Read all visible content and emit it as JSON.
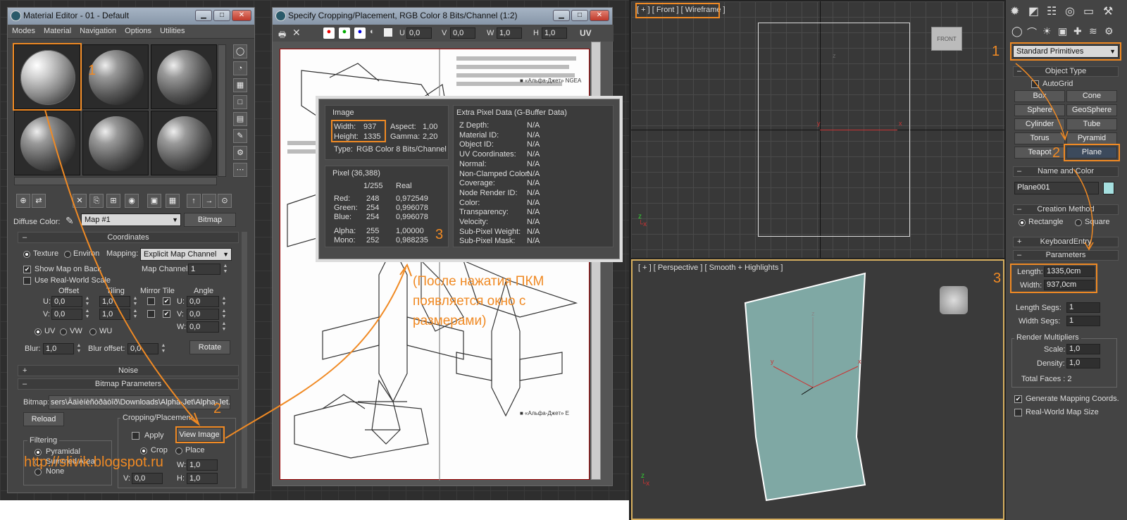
{
  "material_editor": {
    "title": "Material Editor - 01 - Default",
    "menus": [
      "Modes",
      "Material",
      "Navigation",
      "Options",
      "Utilities"
    ],
    "annotation_num": "1",
    "diffuse_label": "Diffuse Color:",
    "map_name": "Map #1",
    "map_type": "Bitmap",
    "coordinates": {
      "rollout": "Coordinates",
      "texture": "Texture",
      "environ": "Environ",
      "mapping_label": "Mapping:",
      "mapping_value": "Explicit Map Channel",
      "show_map": "Show Map on Back",
      "real_world": "Use Real-World Scale",
      "map_channel_label": "Map Channel:",
      "map_channel": "1",
      "offset": "Offset",
      "tiling": "Tiling",
      "mirror_tile": "Mirror Tile",
      "angle": "Angle",
      "u": "U:",
      "v": "V:",
      "w": "W:",
      "u_offset": "0,0",
      "v_offset": "0,0",
      "u_tiling": "1,0",
      "v_tiling": "1,0",
      "u_angle": "0,0",
      "v_angle": "0,0",
      "w_angle": "0,0",
      "uv": "UV",
      "vw": "VW",
      "wu": "WU",
      "blur_label": "Blur:",
      "blur": "1,0",
      "blur_offset_label": "Blur offset:",
      "blur_offset": "0,0",
      "rotate": "Rotate"
    },
    "noise_rollout": "Noise",
    "bitmap_rollout": "Bitmap Parameters",
    "bitmap_label": "Bitmap:",
    "bitmap_path": "sers\\Ääìèíèñòðàòîð\\Downloads\\Alpha-Jet\\Alpha-Jet.jpg",
    "reload": "Reload",
    "cropping_title": "Cropping/Placement",
    "apply": "Apply",
    "view_image": "View Image",
    "annotation_num2": "2",
    "crop": "Crop",
    "place": "Place",
    "filtering": "Filtering",
    "pyramidal": "Pyramidal",
    "summed_area": "Summed Area",
    "none": "None",
    "u_crop": "0,0",
    "w_crop": "1,0",
    "v_crop": "0,0",
    "h_crop": "1,0",
    "w_lbl": "W:",
    "h_lbl": "H:"
  },
  "crop_window": {
    "title": "Specify Cropping/Placement, RGB Color 8 Bits/Channel (1:2)",
    "u_label": "U",
    "u": "0,0",
    "v_label": "V",
    "v": "0,0",
    "w_label": "W",
    "w": "1,0",
    "h_label": "H",
    "h": "1,0",
    "uv": "UV",
    "doc_caption_1": "■ «Альфа-Джет» NGEA",
    "doc_caption_2": "■ «Альфа-Джет» E"
  },
  "info_popup": {
    "image_title": "Image",
    "width_label": "Width:",
    "width": "937",
    "height_label": "Height:",
    "height": "1335",
    "aspect_label": "Aspect:",
    "aspect": "1,00",
    "gamma_label": "Gamma:",
    "gamma": "2,20",
    "type_label": "Type:",
    "type": "RGB Color 8 Bits/Channel",
    "pixel_title": "Pixel (36,388)",
    "col_255": "1/255",
    "col_real": "Real",
    "rows": [
      {
        "label": "Red:",
        "v255": "248",
        "real": "0,972549"
      },
      {
        "label": "Green:",
        "v255": "254",
        "real": "0,996078"
      },
      {
        "label": "Blue:",
        "v255": "254",
        "real": "0,996078"
      }
    ],
    "alpha_label": "Alpha:",
    "alpha_255": "255",
    "alpha_real": "1,00000",
    "mono_label": "Mono:",
    "mono_255": "252",
    "mono_real": "0,988235",
    "annotation_num": "3",
    "extra_title": "Extra Pixel Data (G-Buffer Data)",
    "extra": [
      {
        "label": "Z Depth:",
        "value": "N/A"
      },
      {
        "label": "Material ID:",
        "value": "N/A"
      },
      {
        "label": "Object ID:",
        "value": "N/A"
      },
      {
        "label": "UV Coordinates:",
        "value": "N/A"
      },
      {
        "label": "Normal:",
        "value": "N/A"
      },
      {
        "label": "Non-Clamped Color:",
        "value": "N/A"
      },
      {
        "label": "Coverage:",
        "value": "N/A"
      },
      {
        "label": "Node Render ID:",
        "value": "N/A"
      },
      {
        "label": "Color:",
        "value": "N/A"
      },
      {
        "label": "Transparency:",
        "value": "N/A"
      },
      {
        "label": "Velocity:",
        "value": "N/A"
      },
      {
        "label": "Sub-Pixel Weight:",
        "value": "N/A"
      },
      {
        "label": "Sub-Pixel Mask:",
        "value": "N/A"
      }
    ]
  },
  "annotation_note": "(После нажатия ПКМ появляется окно с размерами)",
  "watermark": "http://slivik.blogspot.ru",
  "viewports": {
    "front_label": "[ + ] [ Front ] [ Wireframe ]",
    "persp_label": "[ + ] [ Perspective ] [ Smooth + Highlights ]",
    "front_cube": "FRONT"
  },
  "command_panel": {
    "category": "Standard Primitives",
    "annotation_1": "1",
    "annotation_2": "2",
    "annotation_3": "3",
    "object_type": "Object Type",
    "autogrid": "AutoGrid",
    "buttons": [
      "Box",
      "Cone",
      "Sphere",
      "GeoSphere",
      "Cylinder",
      "Tube",
      "Torus",
      "Pyramid",
      "Teapot",
      "Plane"
    ],
    "name_and_color": "Name and Color",
    "object_name": "Plane001",
    "color": "#a6e0e0",
    "creation_method": "Creation Method",
    "rectangle": "Rectangle",
    "square": "Square",
    "keyboard_entry": "KeyboardEntry",
    "parameters": "Parameters",
    "length_label": "Length:",
    "length": "1335,0cm",
    "width_label": "Width:",
    "width": "937,0cm",
    "length_segs_label": "Length Segs:",
    "length_segs": "1",
    "width_segs_label": "Width Segs:",
    "width_segs": "1",
    "render_mult": "Render Multipliers",
    "scale_label": "Scale:",
    "scale": "1,0",
    "density_label": "Density:",
    "density": "1,0",
    "total_faces": "Total Faces : 2",
    "gen_mapping": "Generate Mapping Coords.",
    "real_world_map": "Real-World Map Size"
  },
  "colors": {
    "accent": "#f08a24",
    "plane": "#7fa8a4"
  }
}
